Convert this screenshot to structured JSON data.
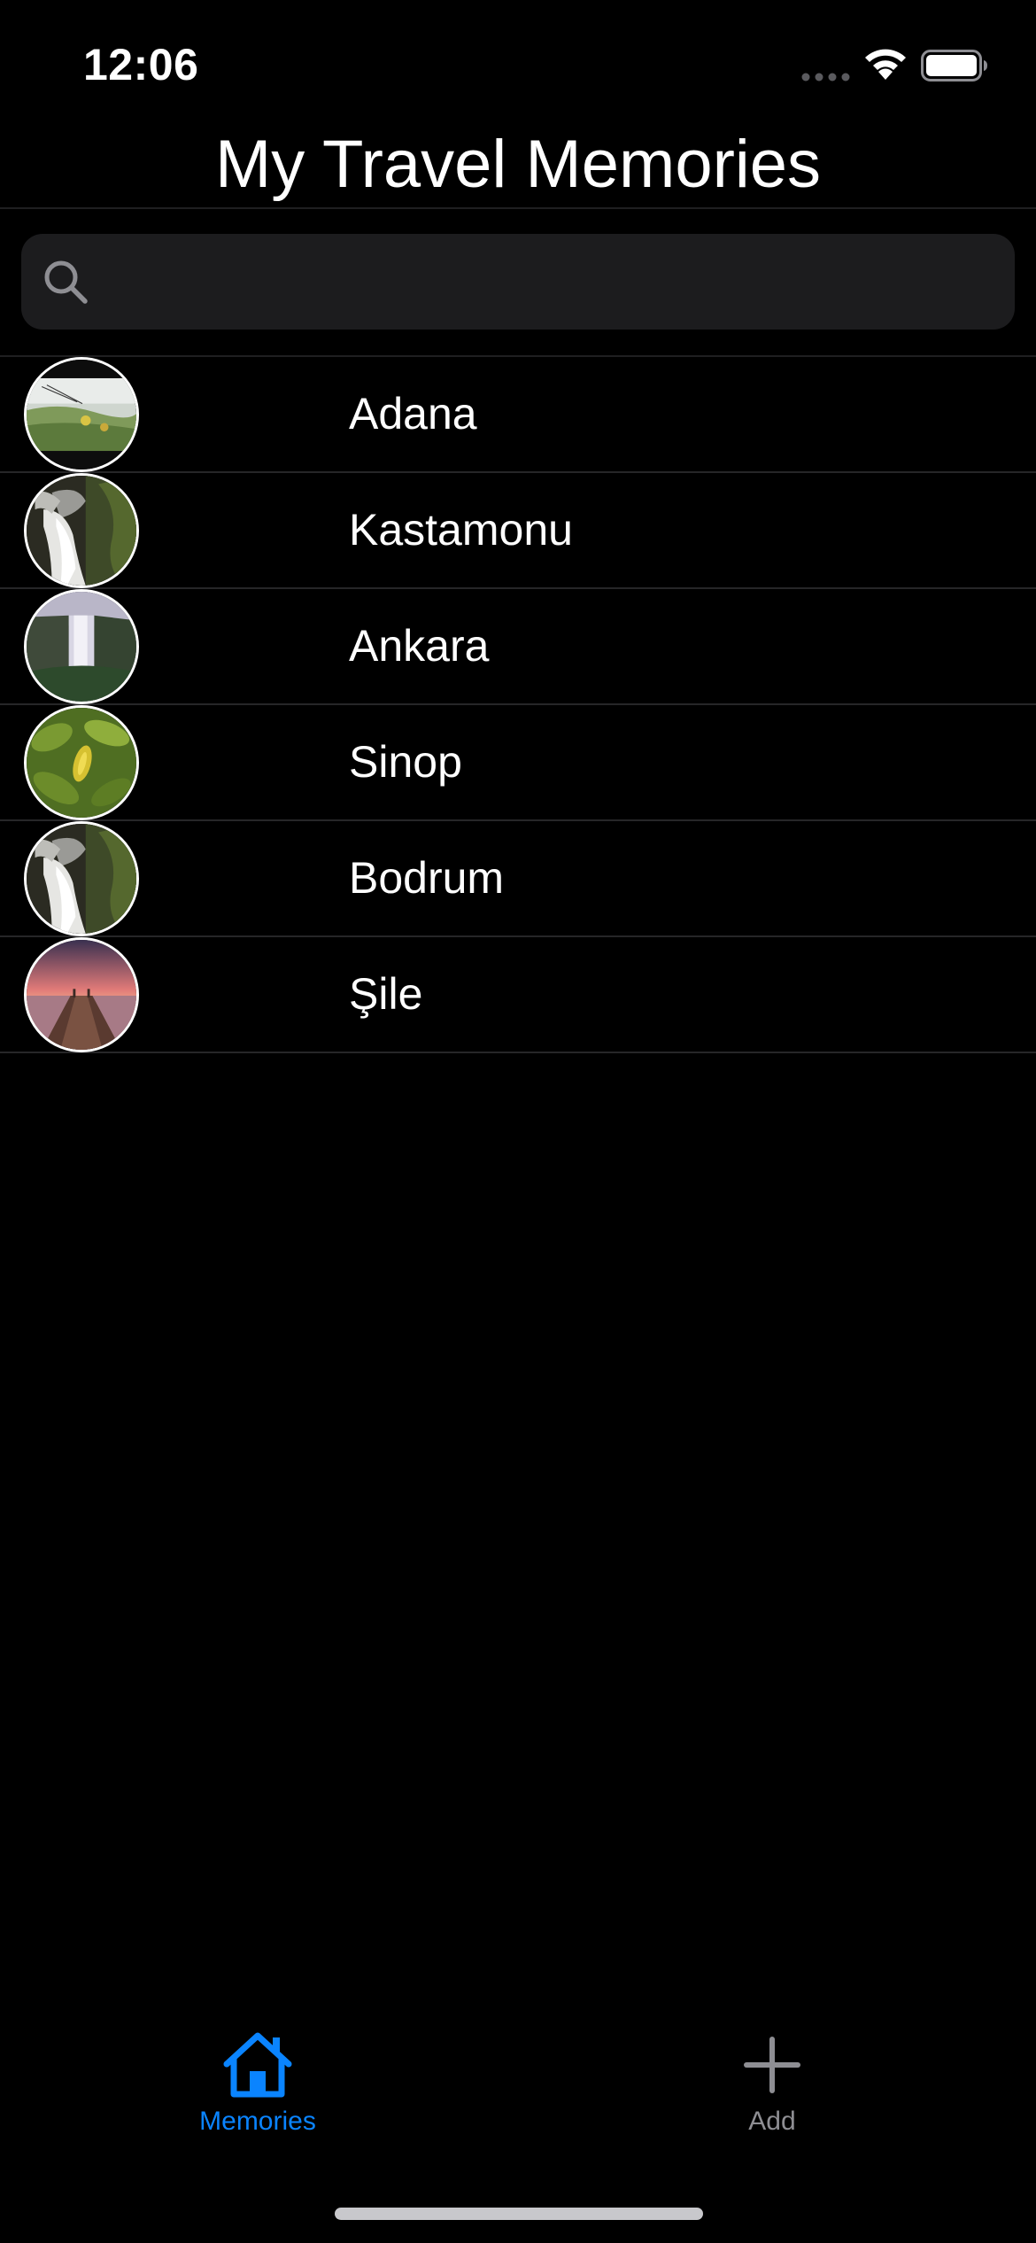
{
  "status_bar": {
    "time": "12:06",
    "icons": [
      "signal-dots-icon",
      "wifi-icon",
      "battery-icon"
    ]
  },
  "nav": {
    "title": "My Travel Memories"
  },
  "search": {
    "placeholder": "",
    "value": ""
  },
  "memories": [
    {
      "name": "Adana",
      "thumbnail": "meadow-photo"
    },
    {
      "name": "Kastamonu",
      "thumbnail": "waterfall-bw-photo"
    },
    {
      "name": "Ankara",
      "thumbnail": "canyon-waterfall-photo"
    },
    {
      "name": "Sinop",
      "thumbnail": "green-leaves-photo"
    },
    {
      "name": "Bodrum",
      "thumbnail": "waterfall-bw-photo"
    },
    {
      "name": "Şile",
      "thumbnail": "pier-sunset-photo"
    }
  ],
  "tabs": [
    {
      "label": "Memories",
      "icon": "house-icon",
      "selected": true
    },
    {
      "label": "Add",
      "icon": "plus-icon",
      "selected": false
    }
  ],
  "colors": {
    "background": "#000000",
    "accent": "#0a84ff",
    "inactive_tab": "#8e8e93",
    "search_field": "#1c1c1e",
    "separator": "#262628"
  }
}
